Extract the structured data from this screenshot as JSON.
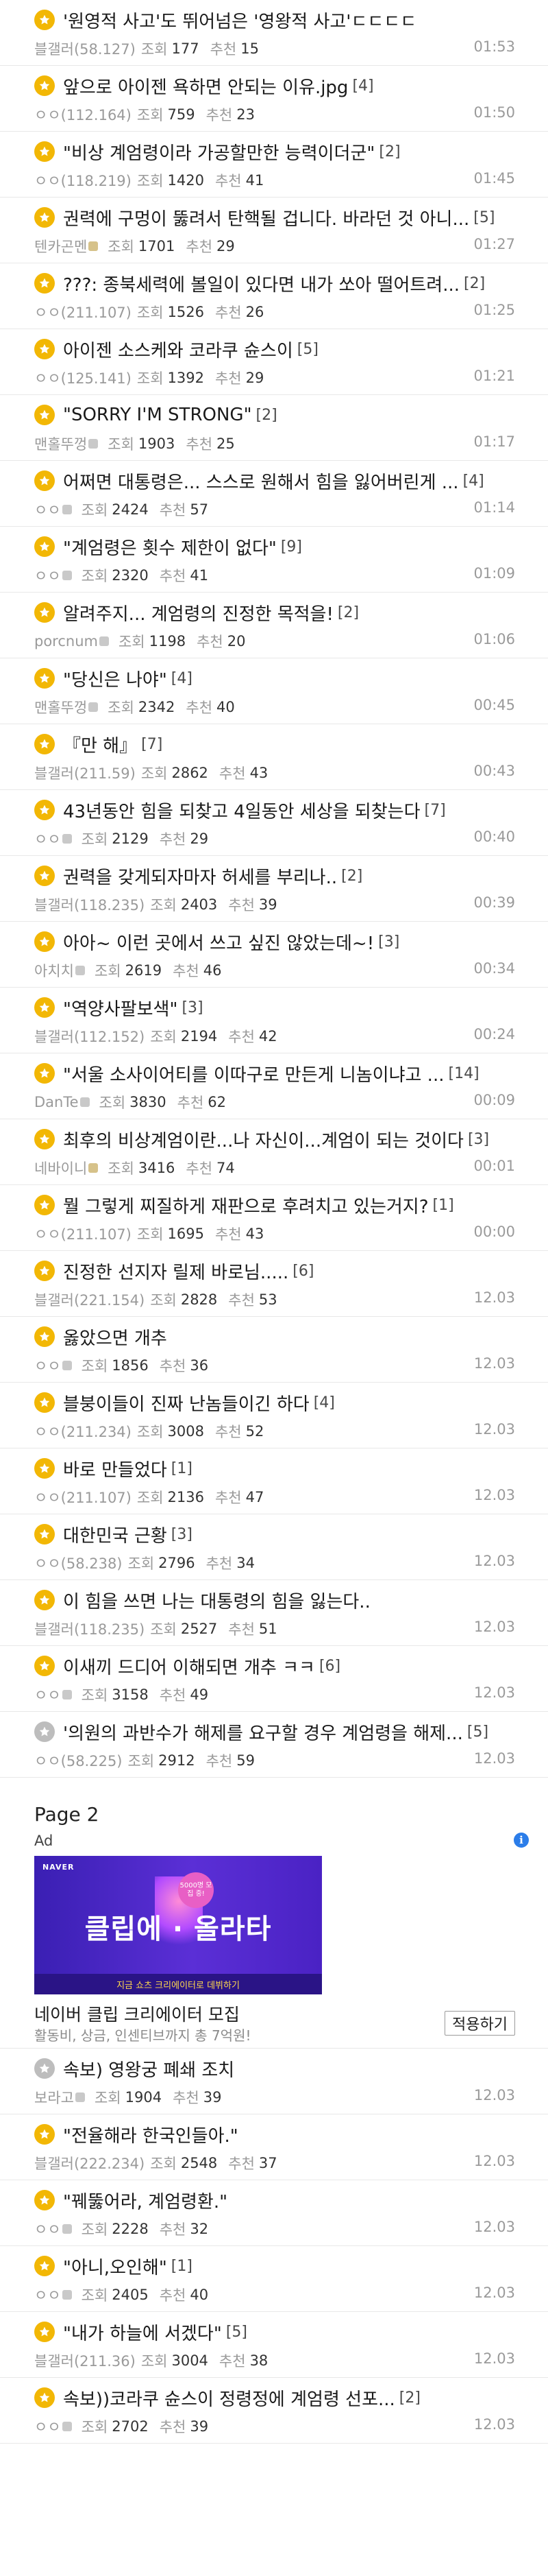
{
  "meta_labels": {
    "views": "조회",
    "recommend": "추천"
  },
  "posts_page1": [
    {
      "title": "'원영적 사고'도 뛰어넘은 '영왕적 사고'ㄷㄷㄷㄷ",
      "count": "",
      "author": "블갤러(58.127)",
      "views": "177",
      "recommend": "15",
      "time": "01:53",
      "icon": "star-icon"
    },
    {
      "title": "앞으로 아이젠 욕하면 안되는 이유.jpg",
      "count": "[4]",
      "author": "ㅇㅇ(112.164)",
      "views": "759",
      "recommend": "23",
      "time": "01:50",
      "icon": "star-icon"
    },
    {
      "title": "\"비상 계엄령이라 가공할만한 능력이더군\"",
      "count": "[2]",
      "author": "ㅇㅇ(118.219)",
      "views": "1420",
      "recommend": "41",
      "time": "01:45",
      "icon": "star-icon"
    },
    {
      "title": "권력에 구멍이 뚫려서 탄핵될 겁니다. 바라던 것 아니...",
      "count": "[5]",
      "author": "텐카곤멘",
      "views": "1701",
      "recommend": "29",
      "time": "01:27",
      "icon": "star-icon",
      "badge": "cafe"
    },
    {
      "title": "???: 종북세력에 볼일이 있다면 내가 쏘아 떨어트려...",
      "count": "[2]",
      "author": "ㅇㅇ(211.107)",
      "views": "1526",
      "recommend": "26",
      "time": "01:25",
      "icon": "star-icon"
    },
    {
      "title": "아이젠 소스케와 코라쿠 슌스이",
      "count": "[5]",
      "author": "ㅇㅇ(125.141)",
      "views": "1392",
      "recommend": "29",
      "time": "01:21",
      "icon": "star-icon"
    },
    {
      "title": "\"SORRY I'M STRONG\"",
      "count": "[2]",
      "author": "맨홀뚜껑",
      "views": "1903",
      "recommend": "25",
      "time": "01:17",
      "icon": "star-icon",
      "badge": "gray"
    },
    {
      "title": "어쩌면 대통령은... 스스로 원해서 힘을 잃어버린게 ...",
      "count": "[4]",
      "author": "ㅇㅇ",
      "views": "2424",
      "recommend": "57",
      "time": "01:14",
      "icon": "star-icon",
      "badge": "gray"
    },
    {
      "title": "\"계엄령은 횟수 제한이 없다\"",
      "count": "[9]",
      "author": "ㅇㅇ",
      "views": "2320",
      "recommend": "41",
      "time": "01:09",
      "icon": "star-icon",
      "badge": "gray"
    },
    {
      "title": "알려주지... 계엄령의 진정한 목적을!",
      "count": "[2]",
      "author": "porcnum",
      "views": "1198",
      "recommend": "20",
      "time": "01:06",
      "icon": "star-icon",
      "badge": "gray"
    },
    {
      "title": "\"당신은 나야\"",
      "count": "[4]",
      "author": "맨홀뚜껑",
      "views": "2342",
      "recommend": "40",
      "time": "00:45",
      "icon": "star-icon",
      "badge": "gray"
    },
    {
      "title": "『만 해』",
      "count": "[7]",
      "author": "블갤러(211.59)",
      "views": "2862",
      "recommend": "43",
      "time": "00:43",
      "icon": "star-icon"
    },
    {
      "title": "43년동안 힘을 되찾고 4일동안 세상을 되찾는다",
      "count": "[7]",
      "author": "ㅇㅇ",
      "views": "2129",
      "recommend": "29",
      "time": "00:40",
      "icon": "star-icon",
      "badge": "gray"
    },
    {
      "title": "권력을 갖게되자마자 허세를 부리나..",
      "count": "[2]",
      "author": "블갤러(118.235)",
      "views": "2403",
      "recommend": "39",
      "time": "00:39",
      "icon": "star-icon"
    },
    {
      "title": "아아~ 이런 곳에서 쓰고 싶진 않았는데~!",
      "count": "[3]",
      "author": "아치치",
      "views": "2619",
      "recommend": "46",
      "time": "00:34",
      "icon": "star-icon",
      "badge": "gray"
    },
    {
      "title": "\"역양사팔보색\"",
      "count": "[3]",
      "author": "블갤러(112.152)",
      "views": "2194",
      "recommend": "42",
      "time": "00:24",
      "icon": "star-icon"
    },
    {
      "title": "\"서울 소사이어티를 이따구로 만든게 니놈이냐고 ...",
      "count": "[14]",
      "author": "DanTe",
      "views": "3830",
      "recommend": "62",
      "time": "00:09",
      "icon": "star-icon",
      "badge": "gray"
    },
    {
      "title": "최후의 비상계엄이란...나 자신이...계엄이 되는 것이다",
      "count": "[3]",
      "author": "네바이니",
      "views": "3416",
      "recommend": "74",
      "time": "00:01",
      "icon": "star-icon",
      "badge": "cafe"
    },
    {
      "title": "뭘 그렇게 찌질하게 재판으로 후려치고 있는거지?",
      "count": "[1]",
      "author": "ㅇㅇ(211.107)",
      "views": "1695",
      "recommend": "43",
      "time": "00:00",
      "icon": "star-icon"
    },
    {
      "title": "진정한 선지자 릴제 바로님.....",
      "count": "[6]",
      "author": "블갤러(221.154)",
      "views": "2828",
      "recommend": "53",
      "time": "12.03",
      "icon": "star-icon"
    },
    {
      "title": "옳았으면 개추",
      "count": "",
      "author": "ㅇㅇ",
      "views": "1856",
      "recommend": "36",
      "time": "12.03",
      "icon": "star-icon",
      "badge": "gray"
    },
    {
      "title": "블붕이들이 진짜 난놈들이긴 하다",
      "count": "[4]",
      "author": "ㅇㅇ(211.234)",
      "views": "3008",
      "recommend": "52",
      "time": "12.03",
      "icon": "star-icon"
    },
    {
      "title": "바로 만들었다",
      "count": "[1]",
      "author": "ㅇㅇ(211.107)",
      "views": "2136",
      "recommend": "47",
      "time": "12.03",
      "icon": "star-icon"
    },
    {
      "title": "대한민국 근황",
      "count": "[3]",
      "author": "ㅇㅇ(58.238)",
      "views": "2796",
      "recommend": "34",
      "time": "12.03",
      "icon": "star-icon"
    },
    {
      "title": "이 힘을 쓰면 나는 대통령의 힘을 잃는다..",
      "count": "",
      "author": "블갤러(118.235)",
      "views": "2527",
      "recommend": "51",
      "time": "12.03",
      "icon": "star-icon"
    },
    {
      "title": "이새끼 드디어 이해되면 개추 ㅋㅋ",
      "count": "[6]",
      "author": "ㅇㅇ",
      "views": "3158",
      "recommend": "49",
      "time": "12.03",
      "icon": "star-icon",
      "badge": "gray"
    },
    {
      "title": "'의원의 과반수가 해제를 요구할 경우 계엄령을 해제...",
      "count": "[5]",
      "author": "ㅇㅇ(58.225)",
      "views": "2912",
      "recommend": "59",
      "time": "12.03",
      "icon": "star-icon",
      "gray": true
    }
  ],
  "page2_label": "Page 2",
  "ad": {
    "tag": "Ad",
    "brand": "NAVER",
    "headline": "클립에 · 올라타",
    "badge": "5000명 모집 중!",
    "footer": "지금 쇼츠 크리에이터로 데뷔하기",
    "title": "네이버 클립 크리에이터 모집",
    "desc": "활동비, 상금, 인센티브까지 총 7억원!",
    "button": "적용하기"
  },
  "posts_page2": [
    {
      "title": "속보) 영왕궁 폐쇄 조치",
      "count": "",
      "author": "보라고",
      "views": "1904",
      "recommend": "39",
      "time": "12.03",
      "icon": "star-icon",
      "gray": true,
      "badge": "gray"
    },
    {
      "title": "\"전율해라 한국인들아.\"",
      "count": "",
      "author": "블갤러(222.234)",
      "views": "2548",
      "recommend": "37",
      "time": "12.03",
      "icon": "star-icon"
    },
    {
      "title": "\"꿰뚫어라, 계엄령환.\"",
      "count": "",
      "author": "ㅇㅇ",
      "views": "2228",
      "recommend": "32",
      "time": "12.03",
      "icon": "star-icon",
      "badge": "gray"
    },
    {
      "title": "\"아니,오인해\"",
      "count": "[1]",
      "author": "ㅇㅇ",
      "views": "2405",
      "recommend": "40",
      "time": "12.03",
      "icon": "star-icon",
      "badge": "gray"
    },
    {
      "title": "\"내가 하늘에 서겠다\"",
      "count": "[5]",
      "author": "블갤러(211.36)",
      "views": "3004",
      "recommend": "38",
      "time": "12.03",
      "icon": "star-icon"
    },
    {
      "title": "속보))코라쿠 슌스이 정령정에 계엄령 선포...",
      "count": "[2]",
      "author": "ㅇㅇ",
      "views": "2702",
      "recommend": "39",
      "time": "12.03",
      "icon": "star-icon",
      "badge": "gray"
    }
  ]
}
